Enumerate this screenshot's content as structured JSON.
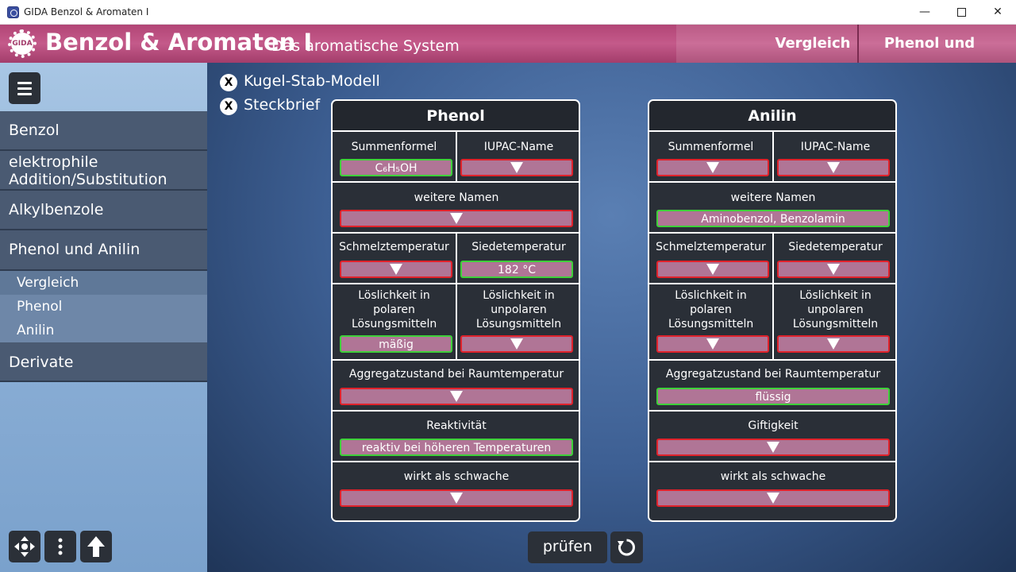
{
  "window": {
    "title": "GIDA Benzol & Aromaten I"
  },
  "header": {
    "logo_text": "GIDA",
    "title": "Benzol & Aromaten I",
    "subtitle": "Das aromatische System",
    "tabs": [
      {
        "label": "Vergleich"
      },
      {
        "label": "Phenol und Anilin"
      }
    ]
  },
  "sidebar": {
    "items": [
      {
        "label": "Benzol"
      },
      {
        "label": "elektrophile Addition/Substitution"
      },
      {
        "label": "Alkylbenzole"
      },
      {
        "label": "Phenol und Anilin"
      },
      {
        "label": "Vergleich"
      },
      {
        "label": "Phenol"
      },
      {
        "label": "Anilin"
      },
      {
        "label": "Derivate"
      }
    ]
  },
  "toggles": [
    {
      "label": "Kugel-Stab-Modell",
      "mark": "X"
    },
    {
      "label": "Steckbrief",
      "mark": "X"
    }
  ],
  "phenol": {
    "title": "Phenol",
    "summenformel_label": "Summenformel",
    "summenformel_value": "C₆H₅OH",
    "iupac_label": "IUPAC-Name",
    "weitere_label": "weitere Namen",
    "schmelz_label": "Schmelztemperatur",
    "siede_label": "Siedetemperatur",
    "siede_value": "182 °C",
    "loes_polar_label": "Löslichkeit in polaren Lösungsmitteln",
    "loes_polar_value": "mäßig",
    "loes_unpolar_label": "Löslichkeit in unpolaren Lösungsmitteln",
    "aggregat_label": "Aggregatzustand bei Raumtemperatur",
    "reakt_label": "Reaktivität",
    "reakt_value": "reaktiv bei höheren Temperaturen",
    "schwache_label": "wirkt als schwache"
  },
  "anilin": {
    "title": "Anilin",
    "summenformel_label": "Summenformel",
    "iupac_label": "IUPAC-Name",
    "weitere_label": "weitere Namen",
    "weitere_value": "Aminobenzol, Benzolamin",
    "schmelz_label": "Schmelztemperatur",
    "siede_label": "Siedetemperatur",
    "loes_polar_label": "Löslichkeit in polaren Lösungsmitteln",
    "loes_unpolar_label": "Löslichkeit in unpolaren Lösungsmitteln",
    "aggregat_label": "Aggregatzustand bei Raumtemperatur",
    "aggregat_value": "flüssig",
    "gift_label": "Giftigkeit",
    "schwache_label": "wirkt als schwache"
  },
  "buttons": {
    "check_label": "prüfen"
  },
  "colors": {
    "header": "#b24576",
    "correct": "#3ed13a",
    "wrong": "#e0222b",
    "field": "#b07596"
  }
}
